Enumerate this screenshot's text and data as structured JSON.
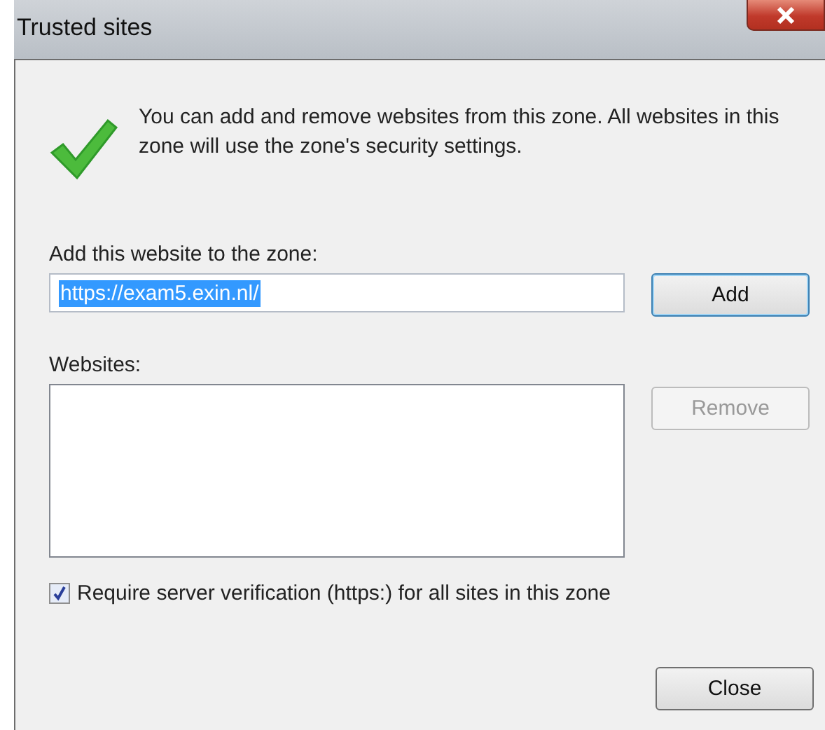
{
  "window": {
    "title": "Trusted sites"
  },
  "message": "You can add and remove websites from this zone. All websites in this zone will use the zone's security settings.",
  "add_label": "Add this website to the zone:",
  "add_field": {
    "value": "https://exam5.exin.nl/",
    "selected": true
  },
  "add_button": {
    "label": "Add",
    "disabled": false
  },
  "websites_label": "Websites:",
  "remove_button": {
    "label": "Remove",
    "disabled": true
  },
  "require_https": {
    "label": "Require server verification (https:) for all sites in this zone",
    "checked": true
  },
  "close_button": {
    "label": "Close"
  }
}
